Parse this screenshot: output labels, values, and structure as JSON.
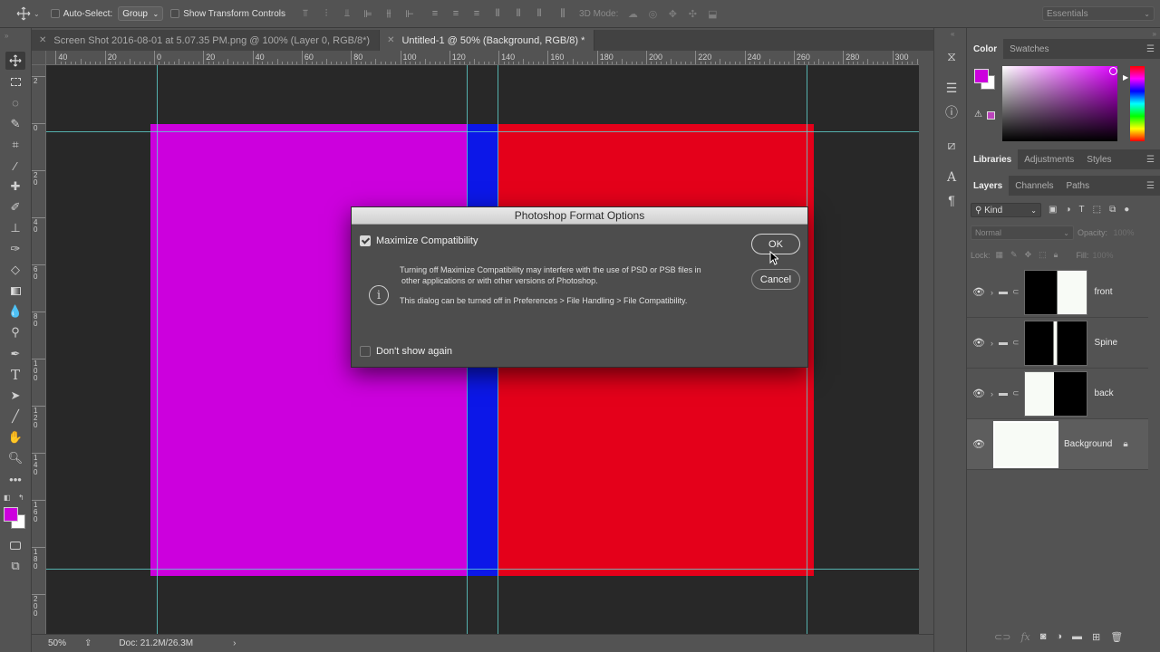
{
  "options_bar": {
    "auto_select_label": "Auto-Select:",
    "auto_select_value": "Group",
    "show_transform_label": "Show Transform Controls",
    "mode_3d_label": "3D Mode:",
    "workspace": "Essentials"
  },
  "tabs": [
    {
      "label": "Screen Shot 2016-08-01 at 5.07.35 PM.png @ 100% (Layer 0, RGB/8*)",
      "active": false
    },
    {
      "label": "Untitled-1 @ 50% (Background, RGB/8) *",
      "active": true
    }
  ],
  "ruler_top": [
    {
      "label": "40"
    },
    {
      "label": "20"
    },
    {
      "label": "0"
    },
    {
      "label": "20"
    },
    {
      "label": "40"
    },
    {
      "label": "60"
    },
    {
      "label": "80"
    },
    {
      "label": "100"
    },
    {
      "label": "120"
    },
    {
      "label": "140"
    },
    {
      "label": "160"
    },
    {
      "label": "180"
    },
    {
      "label": "200"
    },
    {
      "label": "220"
    },
    {
      "label": "240"
    },
    {
      "label": "260"
    },
    {
      "label": "280"
    },
    {
      "label": "300"
    },
    {
      "label": "3"
    }
  ],
  "ruler_left": [
    "2",
    "0",
    "20",
    "40",
    "60",
    "80",
    "100",
    "120",
    "140",
    "160",
    "180",
    "200"
  ],
  "status": {
    "zoom": "50%",
    "doc": "Doc: 21.2M/26.3M"
  },
  "color_panel": {
    "tabs": [
      "Color",
      "Swatches"
    ],
    "foreground": "#cc00dd",
    "background": "#ffffff"
  },
  "libraries_tabs": [
    "Libraries",
    "Adjustments",
    "Styles"
  ],
  "layers_panel": {
    "tabs": [
      "Layers",
      "Channels",
      "Paths"
    ],
    "filter_label": "Kind",
    "blend_mode": "Normal",
    "opacity_label": "Opacity:",
    "opacity_value": "100%",
    "lock_label": "Lock:",
    "fill_label": "Fill:",
    "fill_value": "100%",
    "layers": [
      {
        "name": "front",
        "type": "group"
      },
      {
        "name": "Spine",
        "type": "group"
      },
      {
        "name": "back",
        "type": "group"
      },
      {
        "name": "Background",
        "type": "background"
      }
    ]
  },
  "canvas": {
    "colors": {
      "magenta": "#cc00dd",
      "blue": "#0c17e8",
      "red": "#e4001a",
      "guide": "#5fd3d0"
    }
  },
  "dialog": {
    "title": "Photoshop Format Options",
    "maximize_label": "Maximize Compatibility",
    "maximize_checked": true,
    "message_line1": "Turning off Maximize Compatibility may interfere with the use of PSD or PSB files in",
    "message_line2": "other applications or with other versions of Photoshop.",
    "message_line3": "This dialog can be turned off in Preferences > File Handling > File Compatibility.",
    "dont_show_label": "Don't show again",
    "dont_show_checked": false,
    "ok_label": "OK",
    "cancel_label": "Cancel"
  }
}
